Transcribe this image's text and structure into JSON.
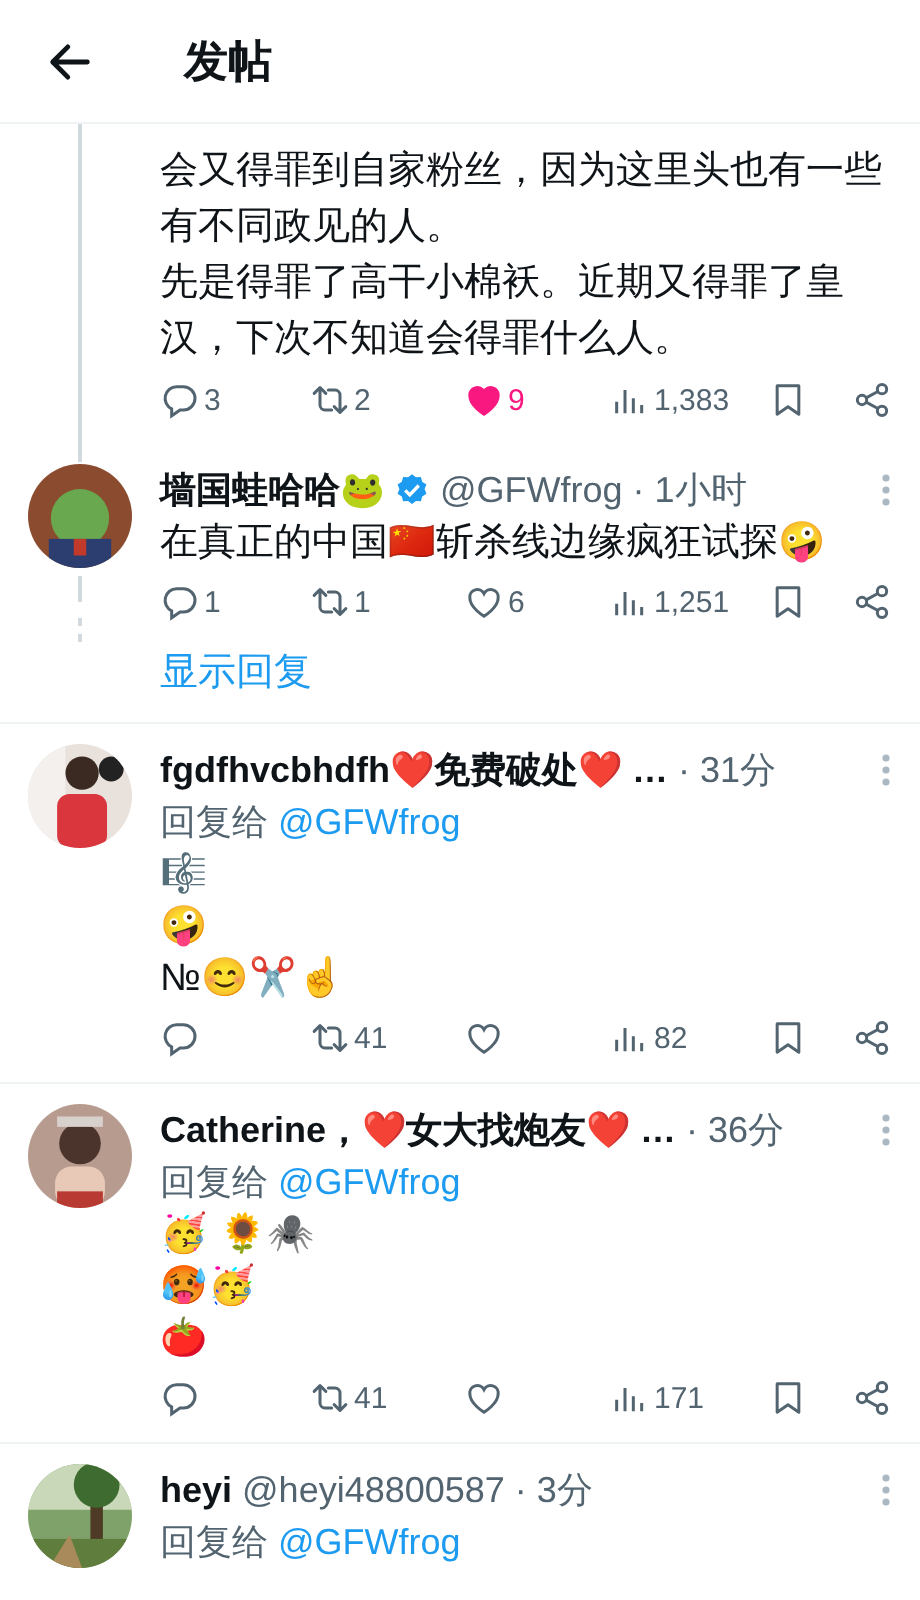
{
  "header": {
    "title": "发帖"
  },
  "thread_tail": {
    "lines": [
      "会又得罪到自家粉丝，因为这里头也有一些有不同政见的人。",
      "先是得罪了高干小棉袄。近期又得罪了皇汉，下次不知道会得罪什么人。"
    ],
    "actions": [
      {
        "kind": "reply",
        "count": "3"
      },
      {
        "kind": "repost",
        "count": "2"
      },
      {
        "kind": "like",
        "count": "9",
        "selected": true
      },
      {
        "kind": "views",
        "count": "1,383"
      },
      {
        "kind": "bookmark"
      },
      {
        "kind": "share"
      }
    ]
  },
  "posts": [
    {
      "name": "墙国蛙哈哈🐸",
      "verified": true,
      "handle": "@GFWfrog",
      "time": "· 1小时",
      "connected": true,
      "lines": [
        "在真正的中国🇨🇳斩杀线边缘疯狂试探🤪"
      ],
      "actions": [
        {
          "kind": "reply",
          "count": "1"
        },
        {
          "kind": "repost",
          "count": "1"
        },
        {
          "kind": "like",
          "count": "6",
          "selected": false
        },
        {
          "kind": "views",
          "count": "1,251"
        },
        {
          "kind": "bookmark"
        },
        {
          "kind": "share"
        }
      ],
      "show_replies": "显示回复"
    },
    {
      "name": "fgdfhvcbhdfh❤️免费破处❤️ …",
      "verified": false,
      "time": "· 31分",
      "connected": false,
      "reply_to": {
        "label": "回复给",
        "handle": "@GFWfrog"
      },
      "lines": [
        "🎼",
        "🤪",
        "№😊✂️☝️"
      ],
      "actions": [
        {
          "kind": "reply"
        },
        {
          "kind": "repost",
          "count": "41"
        },
        {
          "kind": "like",
          "selected": false
        },
        {
          "kind": "views",
          "count": "82"
        },
        {
          "kind": "bookmark"
        },
        {
          "kind": "share"
        }
      ]
    },
    {
      "name": "Catherine，❤️女大找炮友❤️ …",
      "verified": false,
      "time": "· 36分",
      "connected": false,
      "reply_to": {
        "label": "回复给",
        "handle": "@GFWfrog"
      },
      "lines": [
        "🥳 🌻🕷️",
        "🥵🥳",
        "🍅"
      ],
      "actions": [
        {
          "kind": "reply"
        },
        {
          "kind": "repost",
          "count": "41"
        },
        {
          "kind": "like",
          "selected": false
        },
        {
          "kind": "views",
          "count": "171"
        },
        {
          "kind": "bookmark"
        },
        {
          "kind": "share"
        }
      ]
    },
    {
      "name": "heyi",
      "verified": false,
      "handle": "@heyi48800587",
      "time": "· 3分",
      "connected": false,
      "reply_to": {
        "label": "回复给",
        "handle": "@GFWfrog"
      }
    }
  ]
}
